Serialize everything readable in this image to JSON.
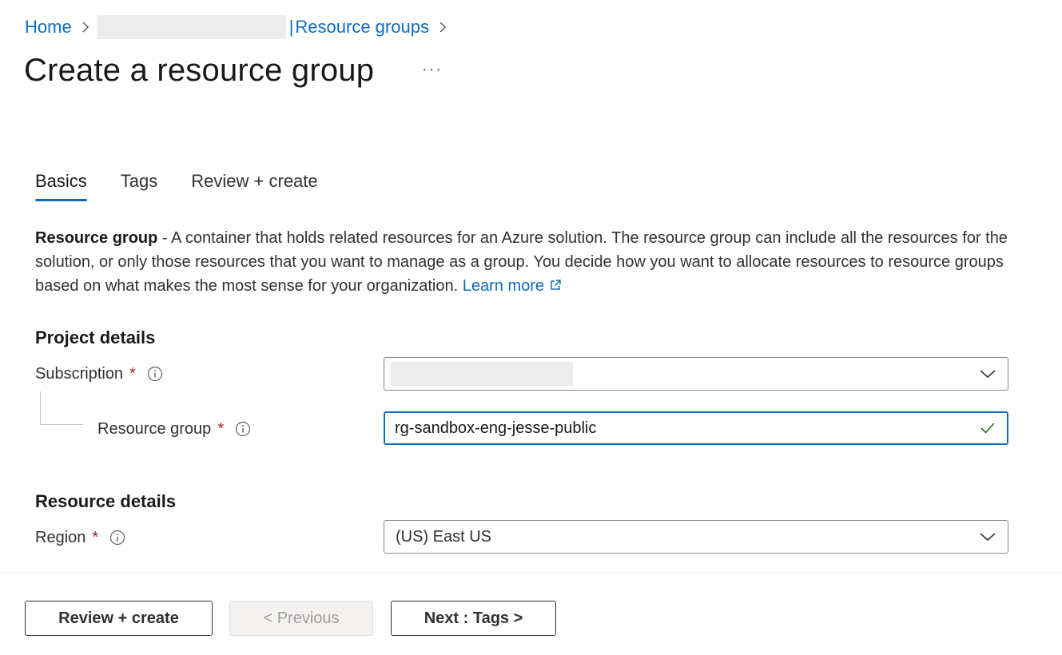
{
  "breadcrumb": {
    "home": "Home",
    "pipe": "|",
    "resource_groups": "Resource groups"
  },
  "page": {
    "title": "Create a resource group",
    "more": "···"
  },
  "tabs": [
    {
      "label": "Basics",
      "active": true
    },
    {
      "label": "Tags",
      "active": false
    },
    {
      "label": "Review + create",
      "active": false
    }
  ],
  "description": {
    "bold": "Resource group",
    "text": " - A container that holds related resources for an Azure solution. The resource group can include all the resources for the solution, or only those resources that you want to manage as a group. You decide how you want to allocate resources to resource groups based on what makes the most sense for your organization. ",
    "link": "Learn more"
  },
  "project_details": {
    "title": "Project details",
    "subscription_label": "Subscription",
    "resource_group_label": "Resource group",
    "resource_group_value": "rg-sandbox-eng-jesse-public",
    "required_mark": "*"
  },
  "resource_details": {
    "title": "Resource details",
    "region_label": "Region",
    "region_value": "(US) East US"
  },
  "footer": {
    "review_create": "Review + create",
    "previous": "< Previous",
    "next": "Next : Tags >"
  },
  "colors": {
    "accent": "#0f6cbd",
    "required": "#a4262c",
    "valid_check": "#107c10"
  },
  "icons": {
    "info": "info-circle-icon",
    "chevron": "chevron-down-icon",
    "external": "external-link-icon",
    "check": "checkmark-icon"
  }
}
